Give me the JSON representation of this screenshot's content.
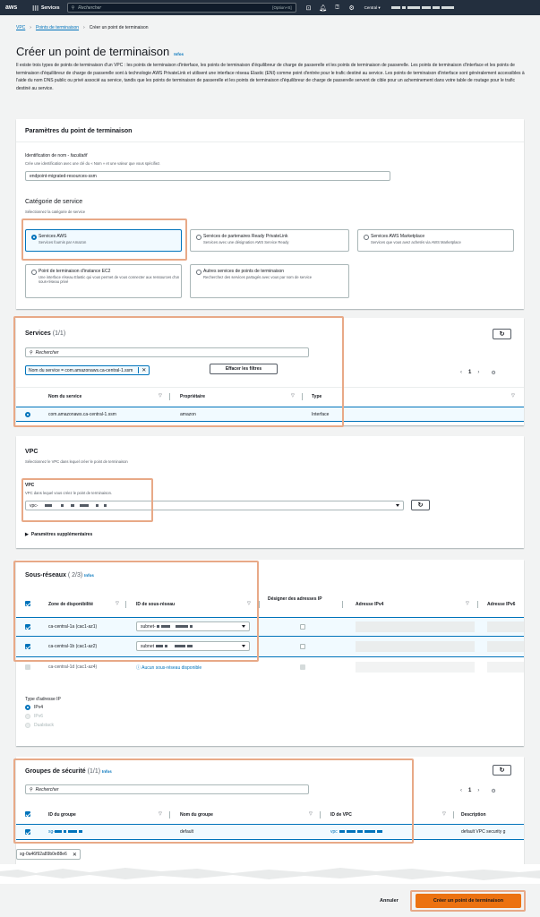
{
  "topbar": {
    "logo": "aws",
    "services": "Services",
    "search_placeholder": "Rechercher",
    "shortcut": "[Option+S]",
    "region": "Central ▾"
  },
  "breadcrumbs": [
    "VPC",
    "Points de terminaison",
    "Créer un point de terminaison"
  ],
  "page": {
    "title": "Créer un point de terminaison",
    "info": "Infos",
    "intro": "Il existe trois types de points de terminaison d'un VPC : les points de terminaison d'interface, les points de terminaison d'équilibreur de charge de passerelle et les points de terminaison de passerelle. Les points de terminaison d'interface et les points de terminaison d'équilibreur de charge de passerelle sont à technologie AWS PrivateLink et utilisent une interface réseau Elastic (ENI) comme point d'entrée pour le trafic destiné au service. Les points de terminaison d'interface sont généralement accessibles à l'aide du nom DNS public ou privé associé au service, tandis que les points de terminaison de passerelle et les points de terminaison d'équilibreur de charge de passerelle servent de cible pour un acheminement dans votre table de routage pour le trafic destiné au service."
  },
  "params": {
    "heading": "Paramètres du point de terminaison",
    "name_label": "Identification de nom - ",
    "name_optional": "facultatif",
    "name_desc": "Crée une identification avec une clé du « Nom » et une valeur que vous spécifiez.",
    "name_value": "endpoint-migrated-resources-ssm",
    "category_label": "Catégorie de service",
    "category_desc": "Sélectionnez la catégorie de service",
    "cards": [
      {
        "title": "Services AWS",
        "desc": "Services fournis par Amazon"
      },
      {
        "title": "Services de partenaires Ready PrivateLink",
        "desc": "Services avec une désignation AWS Service Ready"
      },
      {
        "title": "Services AWS Marketplace",
        "desc": "Services que vous avez achetés via AWS Marketplace"
      },
      {
        "title": "Point de terminaison d'instance EC2",
        "desc": "Une interface réseau Elastic qui vous permet de vous connecter aux ressources d'un sous-réseau privé"
      },
      {
        "title": "Autres services de points de terminaison",
        "desc": "Recherchez des services partagés avec vous par nom de service"
      }
    ]
  },
  "services": {
    "heading": "Services",
    "count": "(1/1)",
    "search_placeholder": "Rechercher",
    "filter_token": "Nom du service = com.amazonaws.ca-central-1.ssm",
    "clear_filters": "Effacer les filtres",
    "page": "1",
    "columns": [
      "Nom du service",
      "Propriétaire",
      "Type"
    ],
    "row": {
      "name": "com.amazonaws.ca-central-1.ssm",
      "owner": "amazon",
      "type": "Interface"
    }
  },
  "vpc": {
    "heading": "VPC",
    "desc": "Sélectionnez le VPC dans lequel créer le point de terminaison",
    "field_label": "VPC",
    "field_desc": "VPC dans lequel vous créez le point de terminaison.",
    "value_prefix": "vpc-",
    "additional": "Paramètres supplémentaires"
  },
  "subnets": {
    "heading": "Sous-réseaux",
    "count": "( 2/3)",
    "info": "Infos",
    "columns": [
      "Zone de disponibilité",
      "ID de sous-réseau",
      "Désigner des adresses IP",
      "Adresse IPv4",
      "Adresse IPv6"
    ],
    "rows": [
      {
        "az": "ca-central-1a (cac1-az1)",
        "subnet": "subnet-",
        "checked": true
      },
      {
        "az": "ca-central-1b (cac1-az2)",
        "subnet": "subnet",
        "checked": true
      },
      {
        "az": "ca-central-1d (cac1-az4)",
        "subnet": "Aucun sous-réseau disponible",
        "checked": false
      }
    ],
    "ip_type_label": "Type d'adresse IP",
    "ip_types": [
      "IPv4",
      "IPv6",
      "Dualstack"
    ]
  },
  "security_groups": {
    "heading": "Groupes de sécurité",
    "count": "(1/1)",
    "info": "Infos",
    "search_placeholder": "Rechercher",
    "page": "1",
    "columns": [
      "ID du groupe",
      "Nom du groupe",
      "ID de VPC",
      "Description"
    ],
    "row": {
      "group_id_prefix": "sg-",
      "name": "default",
      "vpc_prefix": "vpc",
      "description": "default VPC security g"
    },
    "token": "sg-0a46f92a89b0e88e6"
  },
  "footer": {
    "cancel": "Annuler",
    "create": "Créer un point de terminaison"
  },
  "colors": {
    "accent": "#0073bb",
    "primary_button": "#ec7211",
    "highlight": "#e8a987",
    "topbar": "#232f3e"
  }
}
